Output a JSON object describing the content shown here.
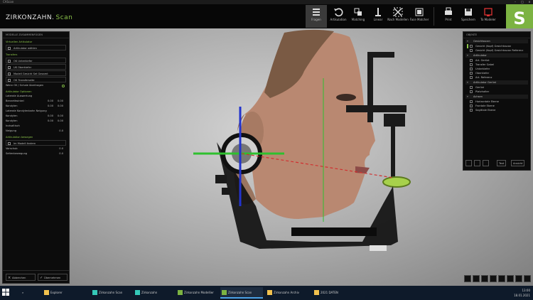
{
  "titlebar": {
    "title": "CAScan"
  },
  "header": {
    "brand_main": "ZIRKONZAHN.",
    "brand_suffix": "Scan",
    "tools": [
      {
        "label": "Fragen",
        "icon": "help-icon"
      },
      {
        "label": "Artikulation",
        "icon": "undo-icon"
      },
      {
        "label": "Matching",
        "icon": "matching-icon"
      },
      {
        "label": "Linear",
        "icon": "linear-icon"
      },
      {
        "label": "Nach Modellen",
        "icon": "crop-icon"
      },
      {
        "label": "Face Matcher",
        "icon": "face-icon"
      },
      {
        "label": "Print",
        "icon": "print-icon"
      },
      {
        "label": "Speichern",
        "icon": "save-icon"
      },
      {
        "label": "To Modeler",
        "icon": "export-icon"
      }
    ],
    "logo_letter": "S"
  },
  "left_panel": {
    "title": "MODELLE ZUSAMMENFÜGEN",
    "section1": "Virtuellen Artikulator",
    "row1": "Artikulator wählen",
    "section2": "Transfers",
    "rows2": [
      "OK Unterkiefer",
      "UK Oberkiefer",
      "Modell Gesicht Set Gesamt",
      "OK Transferseite"
    ],
    "note": "Wenn OK / Schale übertragen",
    "section3": "Artikulator Optionen",
    "sub3": "Laterale Auswertung",
    "values3": [
      {
        "label": "Bennettwinkel",
        "v1": "0.00",
        "v2": "0.00"
      },
      {
        "label": "Kondylen",
        "v1": "0.00",
        "v2": "0.00"
      }
    ],
    "sub4": "Laterale Kondylenbahn Neigung",
    "values4": [
      {
        "label": "Kondylen",
        "v1": "0.00",
        "v2": "0.00"
      },
      {
        "label": "Kondylen",
        "v1": "0.00",
        "v2": "0.00"
      }
    ],
    "sub5": "Inzisaltisch",
    "values5": [
      {
        "label": "Neigung",
        "v1": "0.0",
        "v2": ""
      }
    ],
    "section6": "Artikulation bewegen",
    "row6": "Im Modell ändern",
    "values6": [
      {
        "label": "Vorschub",
        "v1": "0.0",
        "v2": ""
      },
      {
        "label": "Seitenbewegung",
        "v1": "0.0",
        "v2": ""
      }
    ],
    "footer_cancel": "Abbrechen",
    "footer_ok": "Übernehmen"
  },
  "right_panel": {
    "title": "OBJEKTE",
    "groups": [
      {
        "label": "Gesichtsscan",
        "items": [
          "Gesicht (Kopf) Gesichtsscan",
          "Gesicht (Kopf) Gesichtsscan Referenz"
        ]
      },
      {
        "label": "Artikulator",
        "items": [
          "Art. Gerüst",
          "Transfer Gabel",
          "Unterkiefer",
          "Oberkiefer",
          "Art. Referenz"
        ]
      },
      {
        "label": "Artikulator Gerüst",
        "items": [
          "Gerüst",
          "Platzhalter"
        ]
      },
      {
        "label": "Achsen",
        "items": [
          "Horizontale Ebene",
          "Frontale Ebene",
          "Sagittale Ebene"
        ]
      }
    ],
    "toolbar_labels": [
      "Text",
      "Ansicht"
    ]
  },
  "taskbar": {
    "items": [
      {
        "label": "Explorer",
        "color": "#f2c14e"
      },
      {
        "label": "Zirkonzahn Scan",
        "color": "#35c9b8"
      },
      {
        "label": "Zirkonzahn",
        "color": "#35c9b8"
      },
      {
        "label": "Zirkonzahn Modellier",
        "color": "#7cb342"
      },
      {
        "label": "Zirkonzahn Scan",
        "color": "#7cb342"
      },
      {
        "label": "Zirkonzahn Archiv",
        "color": "#f2c14e"
      },
      {
        "label": "2021 DATEN",
        "color": "#f2c14e"
      }
    ],
    "time": "13:00",
    "date": "18.01.2021"
  },
  "colors": {
    "accent": "#7cb342",
    "axis_green": "#2ec02e",
    "axis_blue": "#2233cc",
    "axis_red": "#d03030"
  }
}
